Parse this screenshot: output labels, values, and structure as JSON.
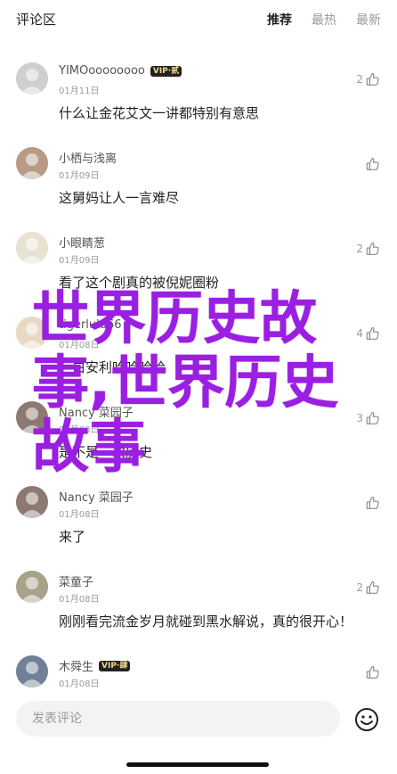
{
  "header": {
    "title": "评论区",
    "tabs": [
      {
        "label": "推荐",
        "active": true
      },
      {
        "label": "最热",
        "active": false
      },
      {
        "label": "最新",
        "active": false
      }
    ]
  },
  "comments": [
    {
      "name": "YIMOoooooooo",
      "badge": "VIP·贰",
      "date": "01月11日",
      "text": "什么让金花艾文一讲都特别有意思",
      "likes": "2",
      "avatar_color": "#cfcfcf"
    },
    {
      "name": "小栖与浅离",
      "badge": "",
      "date": "01月09日",
      "text": "这舅妈让人一言难尽",
      "likes": "",
      "avatar_color": "#b89b86"
    },
    {
      "name": "小眼睛葱",
      "badge": "",
      "date": "01月09日",
      "text": "看了这个剧真的被倪妮圈粉",
      "likes": "2",
      "avatar_color": "#e7e2d2"
    },
    {
      "name": "tigerlulu66",
      "badge": "",
      "date": "01月08日",
      "text": "一白安利哈哈哈哈",
      "likes": "4",
      "avatar_color": "#e9d9c3"
    },
    {
      "name": "Nancy 菜园子",
      "badge": "",
      "date": "01月08日",
      "text": "是不是一次历史",
      "likes": "3",
      "avatar_color": "#8c7a72"
    },
    {
      "name": "Nancy 菜园子",
      "badge": "",
      "date": "01月08日",
      "text": "来了",
      "likes": "",
      "avatar_color": "#8c7a72"
    },
    {
      "name": "菜童子",
      "badge": "",
      "date": "01月08日",
      "text": "刚刚看完流金岁月就碰到黑水解说，真的很开心！",
      "likes": "2",
      "avatar_color": "#a7a28a"
    },
    {
      "name": "木舜生",
      "badge": "VIP·肆",
      "date": "01月08日",
      "text": "",
      "likes": "",
      "avatar_color": "#6f8097"
    }
  ],
  "overlay_text": "世界历史故事,世界历史故事",
  "footer": {
    "input_placeholder": "发表评论",
    "emoji_icon": "emoji-icon"
  },
  "colors": {
    "overlay": "#9b1fe3",
    "badge_bg": "#222222",
    "badge_fg": "#f2d58a"
  }
}
